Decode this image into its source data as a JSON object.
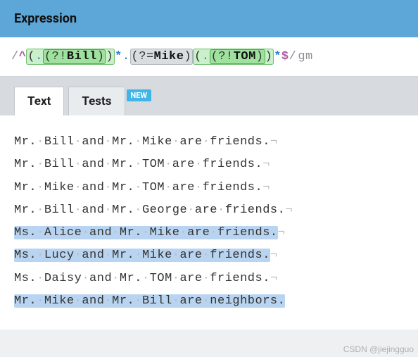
{
  "header": {
    "title": "Expression"
  },
  "regex": {
    "open_delim": "/",
    "anchor_start": "^",
    "group1_open": "(",
    "group1_dot": ".",
    "group1_nla_open": "(?!",
    "group1_nla_text": "Bill",
    "group1_nla_close": ")",
    "group1_close": ")",
    "star1": "*",
    "mid_dot": ".",
    "la_open": "(?=",
    "la_text": "Mike",
    "la_close": ")",
    "group2_open": "(",
    "group2_dot": ".",
    "group2_nla_open": "(?!",
    "group2_nla_text": "TOM",
    "group2_nla_close": ")",
    "group2_close": ")",
    "star2": "*",
    "anchor_end": "$",
    "close_delim": "/",
    "flags": "gm"
  },
  "tabs": {
    "text": "Text",
    "tests": "Tests",
    "badge": "NEW"
  },
  "glyphs": {
    "space": "·",
    "eol": "¬"
  },
  "lines": [
    {
      "segments": [
        {
          "t": "Mr. Bill and Mr. Mike are friends.",
          "hl": false
        }
      ],
      "eol": true
    },
    {
      "segments": [
        {
          "t": "Mr. Bill and Mr. TOM are friends.",
          "hl": false
        }
      ],
      "eol": true
    },
    {
      "segments": [
        {
          "t": "Mr. Mike and Mr. TOM are friends.",
          "hl": false
        }
      ],
      "eol": true
    },
    {
      "segments": [
        {
          "t": "Mr. Bill and Mr. George are friends.",
          "hl": false
        }
      ],
      "eol": true
    },
    {
      "segments": [
        {
          "t": "Ms. Alice and Mr. Mike are friends.",
          "hl": true
        }
      ],
      "eol": true
    },
    {
      "segments": [
        {
          "t": "Ms. Lucy and Mr. Mike are friends.",
          "hl": true
        }
      ],
      "eol": true
    },
    {
      "segments": [
        {
          "t": "Ms. Daisy and Mr. TOM are friends.",
          "hl": false
        }
      ],
      "eol": true
    },
    {
      "segments": [
        {
          "t": "Mr. Mike and Mr. Bill are neighbors.",
          "hl": true
        }
      ],
      "eol": false
    }
  ],
  "watermark": "CSDN @jiejingguo"
}
